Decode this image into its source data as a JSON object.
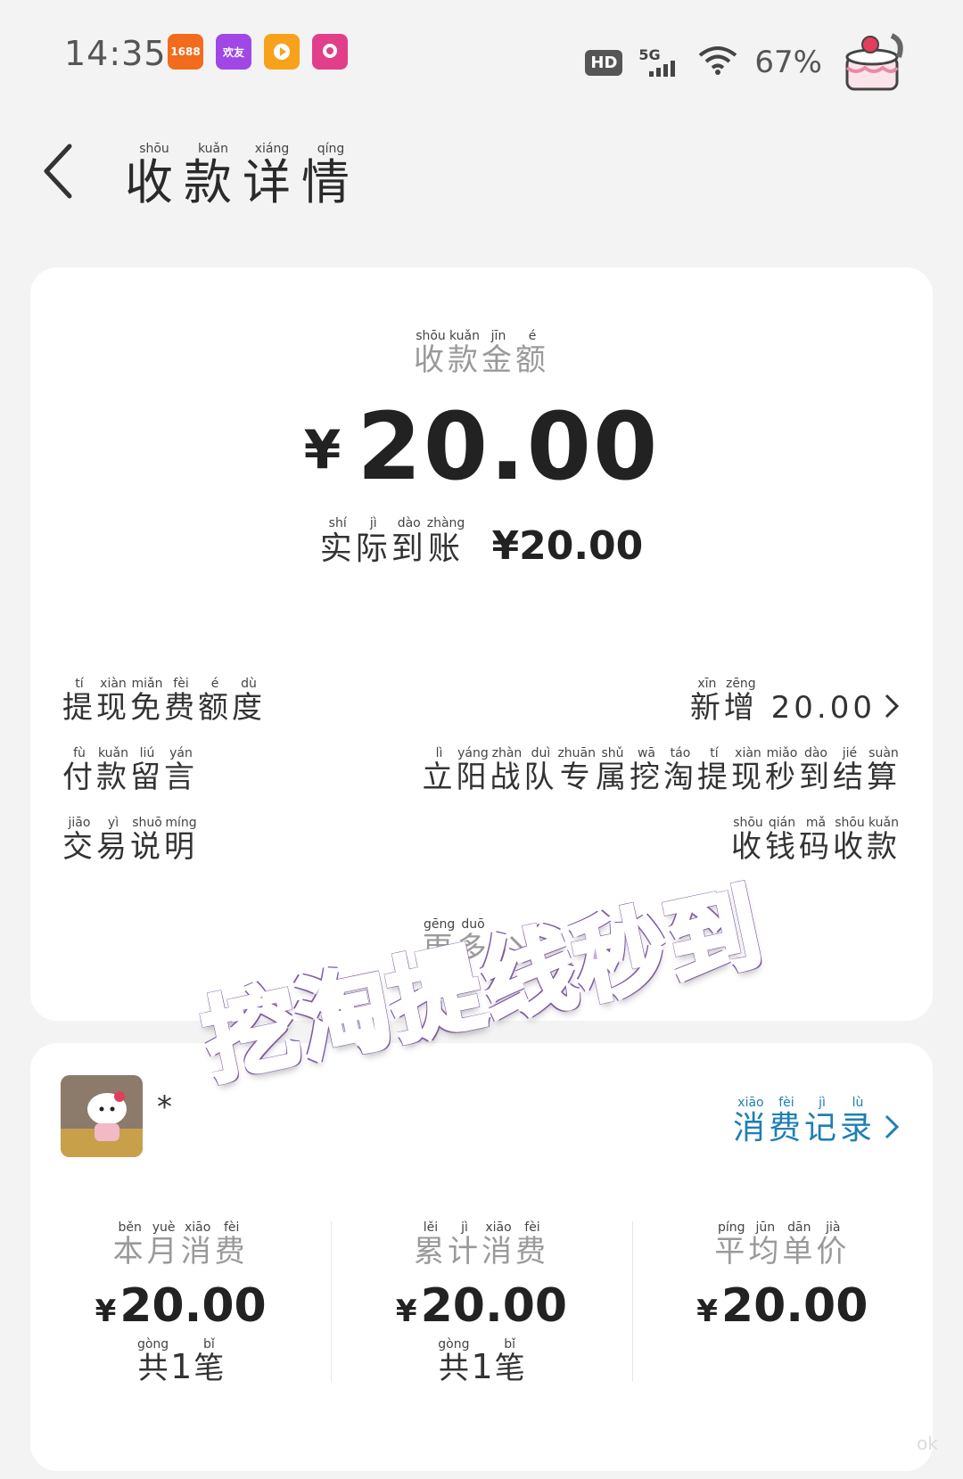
{
  "status_bar": {
    "time": "14:35",
    "apps": [
      "1688",
      "欢友",
      "",
      ""
    ],
    "hd": "HD",
    "network": "5G",
    "battery": "67%"
  },
  "header": {
    "title_chars": [
      {
        "c": "收",
        "py": "shōu"
      },
      {
        "c": "款",
        "py": "kuǎn"
      },
      {
        "c": "详",
        "py": "xiáng"
      },
      {
        "c": "情",
        "py": "qíng"
      }
    ]
  },
  "summary": {
    "caption_chars": [
      {
        "c": "收",
        "py": "shōu"
      },
      {
        "c": "款",
        "py": "kuǎn"
      },
      {
        "c": "金",
        "py": "jīn"
      },
      {
        "c": "额",
        "py": "é"
      }
    ],
    "currency": "¥",
    "amount": "20.00",
    "received_chars": [
      {
        "c": "实",
        "py": "shí"
      },
      {
        "c": "际",
        "py": "jì"
      },
      {
        "c": "到",
        "py": "dào"
      },
      {
        "c": "账",
        "py": "zhàng"
      }
    ],
    "received_value": "¥20.00"
  },
  "details": [
    {
      "key_chars": [
        {
          "c": "提",
          "py": "tí"
        },
        {
          "c": "现",
          "py": "xiàn"
        },
        {
          "c": "免",
          "py": "miǎn"
        },
        {
          "c": "费",
          "py": "fèi"
        },
        {
          "c": "额",
          "py": "é"
        },
        {
          "c": "度",
          "py": "dù"
        }
      ],
      "value_chars": [
        {
          "c": "新",
          "py": "xīn"
        },
        {
          "c": "增",
          "py": "zēng"
        }
      ],
      "value_suffix": " 20.00",
      "has_link": true
    },
    {
      "key_chars": [
        {
          "c": "付",
          "py": "fù"
        },
        {
          "c": "款",
          "py": "kuǎn"
        },
        {
          "c": "留",
          "py": "liú"
        },
        {
          "c": "言",
          "py": "yán"
        }
      ],
      "value_chars": [
        {
          "c": "立",
          "py": "lì"
        },
        {
          "c": "阳",
          "py": "yáng"
        },
        {
          "c": "战",
          "py": "zhàn"
        },
        {
          "c": "队",
          "py": "duì"
        },
        {
          "c": "专",
          "py": "zhuān"
        },
        {
          "c": "属",
          "py": "shǔ"
        },
        {
          "c": "挖",
          "py": "wā"
        },
        {
          "c": "淘",
          "py": "táo"
        },
        {
          "c": "提",
          "py": "tí"
        },
        {
          "c": "现",
          "py": "xiàn"
        },
        {
          "c": "秒",
          "py": "miǎo"
        },
        {
          "c": "到",
          "py": "dào"
        },
        {
          "c": "结",
          "py": "jié"
        },
        {
          "c": "算",
          "py": "suàn"
        }
      ],
      "value_suffix": "",
      "has_link": false
    },
    {
      "key_chars": [
        {
          "c": "交",
          "py": "jiāo"
        },
        {
          "c": "易",
          "py": "yì"
        },
        {
          "c": "说",
          "py": "shuō"
        },
        {
          "c": "明",
          "py": "míng"
        }
      ],
      "value_chars": [
        {
          "c": "收",
          "py": "shōu"
        },
        {
          "c": "钱",
          "py": "qián"
        },
        {
          "c": "码",
          "py": "mǎ"
        },
        {
          "c": "收",
          "py": "shōu"
        },
        {
          "c": "款",
          "py": "kuǎn"
        }
      ],
      "value_suffix": "",
      "has_link": false
    }
  ],
  "more_chars": [
    {
      "c": "更",
      "py": "gēng"
    },
    {
      "c": "多",
      "py": "duō"
    }
  ],
  "customer": {
    "name": "*",
    "link_chars": [
      {
        "c": "消",
        "py": "xiāo"
      },
      {
        "c": "费",
        "py": "fèi"
      },
      {
        "c": "记",
        "py": "jì"
      },
      {
        "c": "录",
        "py": "lù"
      }
    ]
  },
  "stats": [
    {
      "label_chars": [
        {
          "c": "本",
          "py": "běn"
        },
        {
          "c": "月",
          "py": "yuè"
        },
        {
          "c": "消",
          "py": "xiāo"
        },
        {
          "c": "费",
          "py": "fèi"
        }
      ],
      "currency": "¥",
      "value": "20.00",
      "count_pre": {
        "c": "共",
        "py": "gòng"
      },
      "count": "1",
      "count_post": {
        "c": "笔",
        "py": "bǐ"
      }
    },
    {
      "label_chars": [
        {
          "c": "累",
          "py": "lěi"
        },
        {
          "c": "计",
          "py": "jì"
        },
        {
          "c": "消",
          "py": "xiāo"
        },
        {
          "c": "费",
          "py": "fèi"
        }
      ],
      "currency": "¥",
      "value": "20.00",
      "count_pre": {
        "c": "共",
        "py": "gòng"
      },
      "count": "1",
      "count_post": {
        "c": "笔",
        "py": "bǐ"
      }
    },
    {
      "label_chars": [
        {
          "c": "平",
          "py": "píng"
        },
        {
          "c": "均",
          "py": "jūn"
        },
        {
          "c": "单",
          "py": "dān"
        },
        {
          "c": "价",
          "py": "jià"
        }
      ],
      "currency": "¥",
      "value": "20.00",
      "count_pre": null,
      "count": "",
      "count_post": null
    }
  ],
  "watermark": "挖淘提线秒到",
  "corner_mark": "ok",
  "colors": {
    "background": "#f3f3f3",
    "card": "#ffffff",
    "link": "#1f7fb3",
    "muted": "#9a9a9a",
    "watermark_fill": "#c9a6e6",
    "watermark_outline": "#7f5aa3"
  }
}
